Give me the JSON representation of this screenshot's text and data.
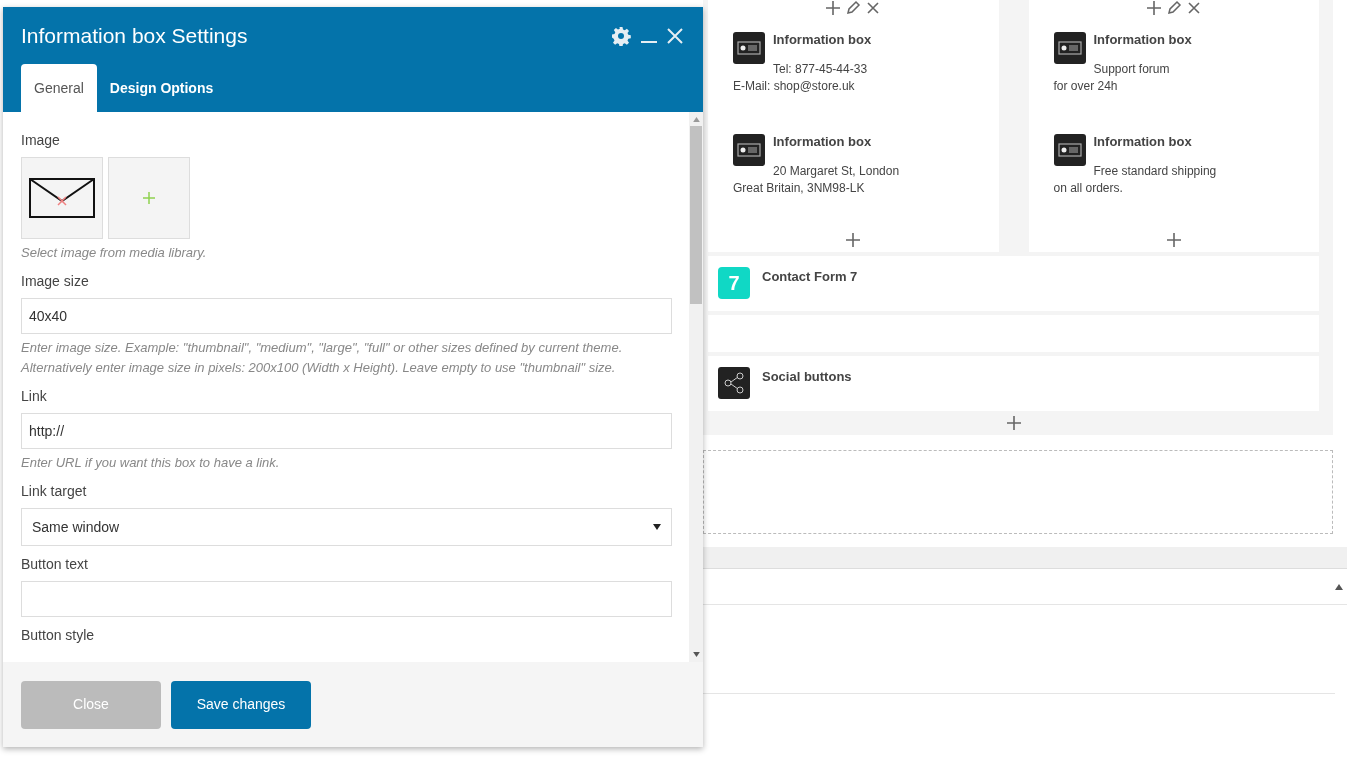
{
  "background": {
    "info_columns": [
      {
        "boxes": [
          {
            "title": "Information box",
            "line_1": "Tel: 877-45-44-33",
            "line_2": "E-Mail: shop@store.uk"
          },
          {
            "title": "Information box",
            "line_1": "20 Margaret St, London",
            "line_2": "Great Britain, 3NM98-LK"
          }
        ]
      },
      {
        "boxes": [
          {
            "title": "Information box",
            "line_1": "Support forum",
            "line_2": "for over 24h"
          },
          {
            "title": "Information box",
            "line_1": "Free standard shipping",
            "line_2": "on all orders."
          }
        ]
      }
    ],
    "elements": [
      {
        "kind": "badge",
        "badge": "7",
        "title": "Contact Form 7"
      },
      {
        "kind": "empty"
      },
      {
        "kind": "share",
        "title": "Social buttons"
      }
    ]
  },
  "modal": {
    "title": "Information box Settings",
    "tabs": [
      {
        "label": "General",
        "selected": true
      },
      {
        "label": "Design Options",
        "selected": false
      }
    ],
    "fields": [
      {
        "kind": "image",
        "label": "Image",
        "help": "Select image from media library."
      },
      {
        "kind": "text",
        "label": "Image size",
        "value": "40x40",
        "help": "Enter image size. Example: \"thumbnail\", \"medium\", \"large\", \"full\" or other sizes defined by current theme. Alternatively enter image size in pixels: 200x100 (Width x Height). Leave empty to use \"thumbnail\" size."
      },
      {
        "kind": "text",
        "label": "Link",
        "value": "http://",
        "help": "Enter URL if you want this box to have a link."
      },
      {
        "kind": "select",
        "label": "Link target",
        "value": "Same window"
      },
      {
        "kind": "text",
        "label": "Button text"
      },
      {
        "kind": "label",
        "label": "Button style"
      }
    ],
    "buttons": [
      {
        "label": "Close",
        "kind": "secondary"
      },
      {
        "label": "Save changes",
        "kind": "primary"
      }
    ]
  }
}
